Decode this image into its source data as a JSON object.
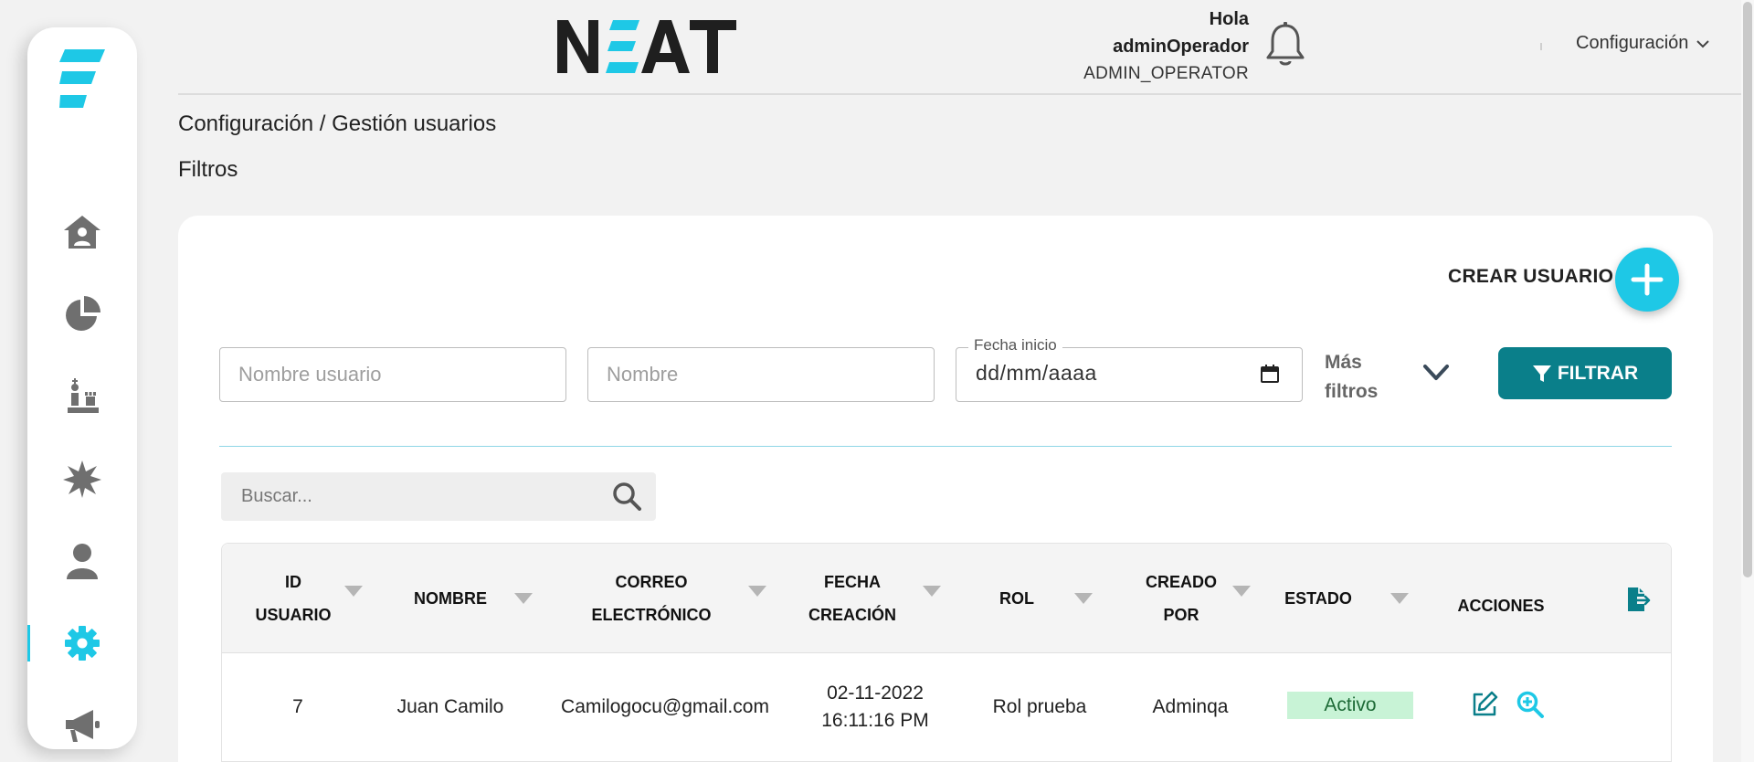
{
  "brand": {
    "name": "NEAT"
  },
  "user": {
    "greeting": "Hola",
    "username": "adminOperador",
    "role": "ADMIN_OPERATOR"
  },
  "header": {
    "config_menu_label": "Configuración"
  },
  "sidebar": {
    "items": [
      {
        "icon": "home-user-icon"
      },
      {
        "icon": "pie-chart-icon"
      },
      {
        "icon": "chess-pieces-icon"
      },
      {
        "icon": "starburst-icon"
      },
      {
        "icon": "user-icon"
      },
      {
        "icon": "gear-icon",
        "active": true
      },
      {
        "icon": "megaphone-icon"
      }
    ]
  },
  "breadcrumb": "Configuración / Gestión usuarios",
  "filters": {
    "title": "Filtros",
    "create_user_label": "CREAR USUARIO",
    "username_placeholder": "Nombre usuario",
    "name_placeholder": "Nombre",
    "date_label": "Fecha inicio",
    "date_value": "dd/mm/aaaa",
    "more_filters_line1": "Más",
    "more_filters_line2": "filtros",
    "filter_button_label": "FILTRAR"
  },
  "search": {
    "placeholder": "Buscar..."
  },
  "table": {
    "columns": [
      {
        "line1": "ID",
        "line2": "USUARIO"
      },
      {
        "line1": "NOMBRE",
        "line2": ""
      },
      {
        "line1": "CORREO",
        "line2": "ELECTRÓNICO"
      },
      {
        "line1": "FECHA",
        "line2": "CREACIÓN"
      },
      {
        "line1": "ROL",
        "line2": ""
      },
      {
        "line1": "CREADO",
        "line2": "POR"
      },
      {
        "line1": "ESTADO",
        "line2": ""
      },
      {
        "line1": "ACCIONES",
        "line2": ""
      }
    ],
    "rows": [
      {
        "id": "7",
        "name": "Juan Camilo",
        "email": "Camilogocu@gmail.com",
        "date": "02-11-2022",
        "time": "16:11:16 PM",
        "role": "Rol prueba",
        "created_by": "Adminqa",
        "status": "Activo"
      }
    ]
  },
  "colors": {
    "accent": "#1ec8e6",
    "primary_button": "#0a7f8a",
    "status_active_bg": "#c8f3d6",
    "status_active_text": "#1e6b37",
    "icon_gray": "#6f6f6f"
  }
}
